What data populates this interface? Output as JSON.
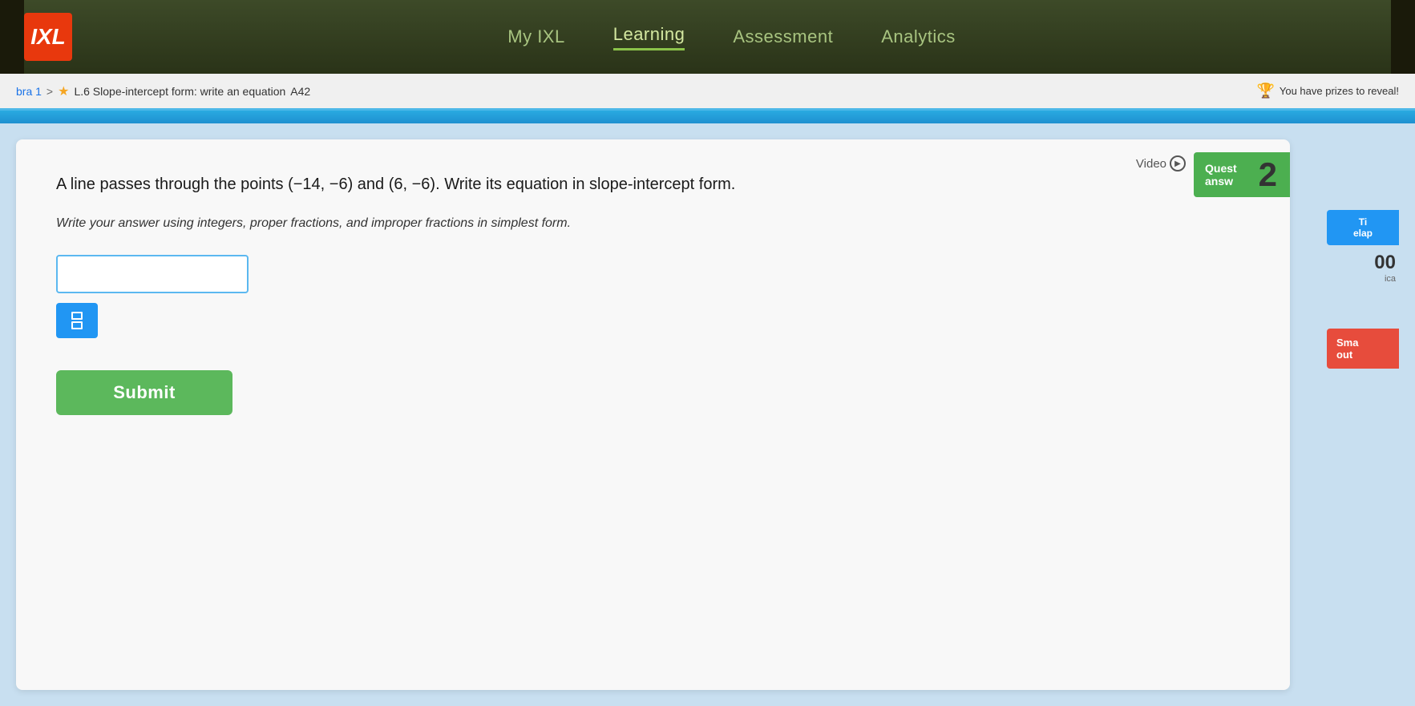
{
  "nav": {
    "logo": "IXL",
    "links": [
      {
        "id": "my-ixl",
        "label": "My IXL"
      },
      {
        "id": "learning",
        "label": "Learning"
      },
      {
        "id": "assessment",
        "label": "Assessment"
      },
      {
        "id": "analytics",
        "label": "Analytics"
      }
    ]
  },
  "breadcrumb": {
    "parent": "bra 1",
    "separator": ">",
    "star": "★",
    "current": "L.6 Slope-intercept form: write an equation",
    "code": "A42",
    "prizes_label": "You have prizes to reveal!"
  },
  "question": {
    "video_label": "Video",
    "quest_label": "Quest\nanswer",
    "number_badge": "2",
    "question_text": "A line passes through the points (−14, −6) and (6, −6). Write its equation in slope-intercept form.",
    "instruction_text": "Write your answer using integers, proper fractions, and improper fractions in simplest form.",
    "answer_placeholder": "",
    "time_label": "Ti\nelap",
    "time_value": "00",
    "elapsed_sub": "ica",
    "smartscore_label": "Sma\nout",
    "submit_label": "Submit"
  }
}
